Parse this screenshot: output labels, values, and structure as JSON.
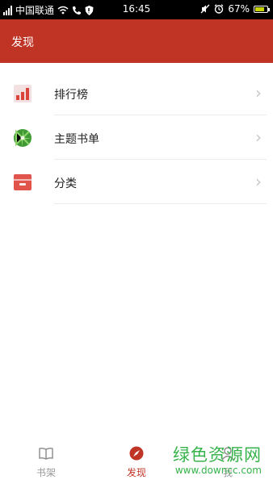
{
  "status_bar": {
    "carrier": "中国联通",
    "time": "16:45",
    "battery_percent": "67%"
  },
  "header": {
    "title": "发现"
  },
  "list": {
    "items": [
      {
        "label": "排行榜",
        "icon": "ranking-chart-icon"
      },
      {
        "label": "主题书单",
        "icon": "theme-booklist-icon"
      },
      {
        "label": "分类",
        "icon": "category-box-icon"
      }
    ]
  },
  "tabbar": {
    "items": [
      {
        "label": "书架",
        "icon": "open-book-icon",
        "active": false
      },
      {
        "label": "发现",
        "icon": "compass-icon",
        "active": true
      },
      {
        "label": "我",
        "icon": "user-icon",
        "active": false
      }
    ]
  },
  "watermark": {
    "title": "绿色资源网",
    "url": "www.downcc.com"
  },
  "colors": {
    "accent": "#bf3425",
    "inactive": "#9a9a9a",
    "watermark": "#36b34a"
  }
}
